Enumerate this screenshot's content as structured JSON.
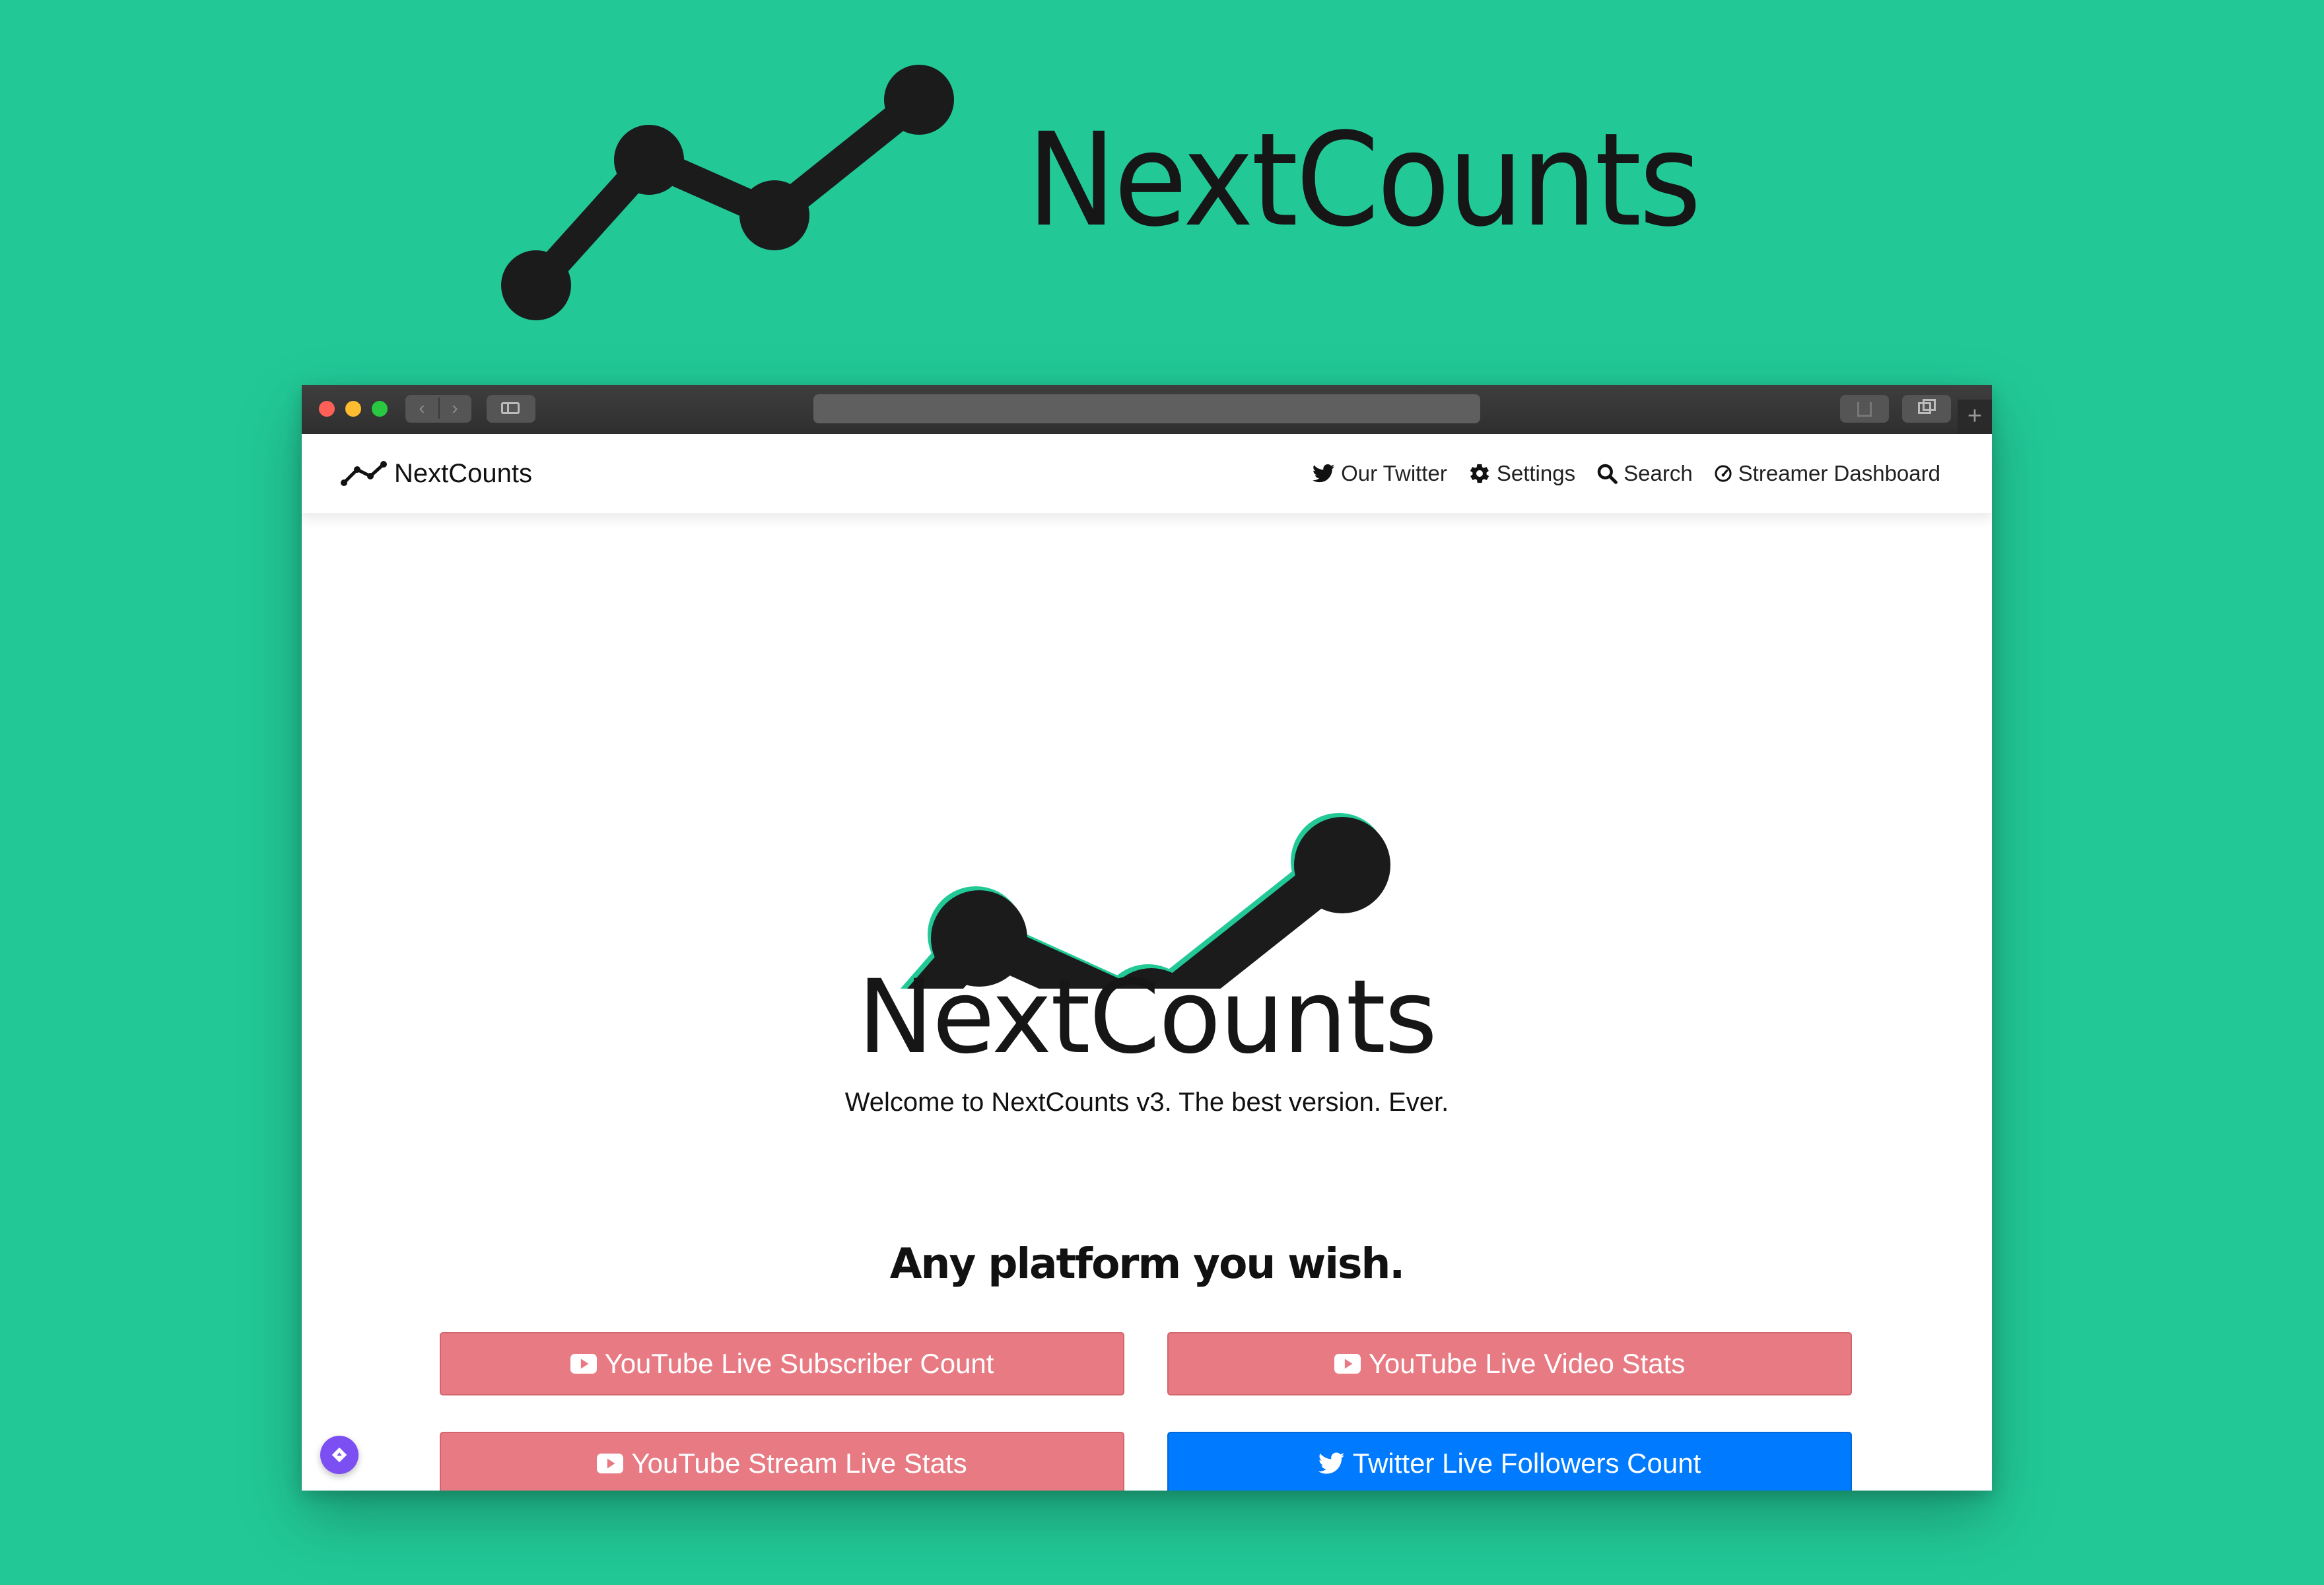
{
  "hero": {
    "title": "NextCounts"
  },
  "colors": {
    "background": "#22c997",
    "youtube_button": "#e77a83",
    "twitter_button": "#007bff",
    "float_button": "#7b4ff2"
  },
  "browser": {
    "icons": [
      "back-icon",
      "forward-icon",
      "sidebar-icon",
      "share-icon",
      "tabs-icon",
      "new-tab-icon"
    ],
    "new_tab_symbol": "+"
  },
  "navbar": {
    "brand": "NextCounts",
    "links": [
      {
        "label": "Our Twitter",
        "icon": "twitter-icon"
      },
      {
        "label": "Settings",
        "icon": "gear-icon"
      },
      {
        "label": "Search",
        "icon": "search-icon"
      },
      {
        "label": "Streamer Dashboard",
        "icon": "dashboard-icon"
      }
    ]
  },
  "main": {
    "title": "NextCounts",
    "subtitle": "Welcome to NextCounts v3. The best version. Ever.",
    "section_heading": "Any platform you wish.",
    "buttons": [
      {
        "label": "YouTube Live Subscriber Count",
        "icon": "youtube-icon"
      },
      {
        "label": "YouTube Live Video Stats",
        "icon": "youtube-icon"
      },
      {
        "label": "YouTube Stream Live Stats",
        "icon": "youtube-icon"
      },
      {
        "label": "Twitter Live Followers Count",
        "icon": "twitter-icon"
      }
    ]
  }
}
